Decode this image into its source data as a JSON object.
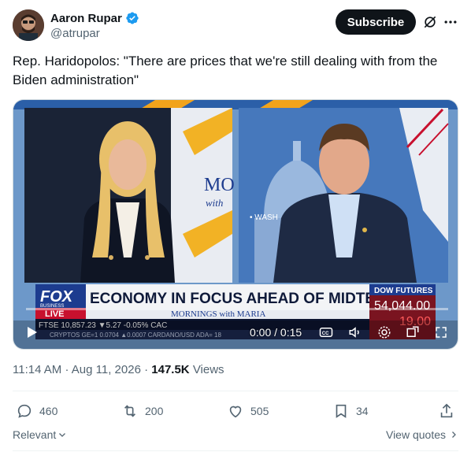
{
  "author": {
    "name": "Aaron Rupar",
    "handle": "@atrupar"
  },
  "header": {
    "subscribe_label": "Subscribe"
  },
  "tweet": {
    "text": "Rep. Haridopolos: \"There are prices that we're still dealing with from the Biden administration\""
  },
  "video": {
    "time": "0:00 / 0:15",
    "lower_third": {
      "network": "FOX",
      "network_sub": "BUSINESS",
      "live": "LIVE",
      "headline": "ECONOMY IN FOCUS AHEAD OF MIDTERMS",
      "show_name": "MORNINGS with MARIA",
      "dow_label": "DOW FUTURES",
      "dow_value": "54,044.00",
      "dow_change": "19.00",
      "ticker": "FTSE   10,857.23  ▼5.27  -0.05%   CAC",
      "ticker2": "CRYPTOS   GE=1  0.0704  ▲0.0007   CARDANO/USD ADA=  18",
      "bg_sign_partial": "MO",
      "bg_sign_partial2": "with",
      "bg_wash": "• WASH"
    }
  },
  "meta": {
    "time": "11:14 AM",
    "separator": "·",
    "date": "Aug 11, 2026",
    "views_num": "147.5K",
    "views_label": "Views"
  },
  "actions": {
    "replies": "460",
    "reposts": "200",
    "likes": "505",
    "bookmarks": "34"
  },
  "footer": {
    "relevant": "Relevant",
    "view_quotes": "View quotes"
  },
  "colors": {
    "verified": "#1d9bf0",
    "fox_red": "#c8102e",
    "fox_blue": "#1d3c8f"
  }
}
